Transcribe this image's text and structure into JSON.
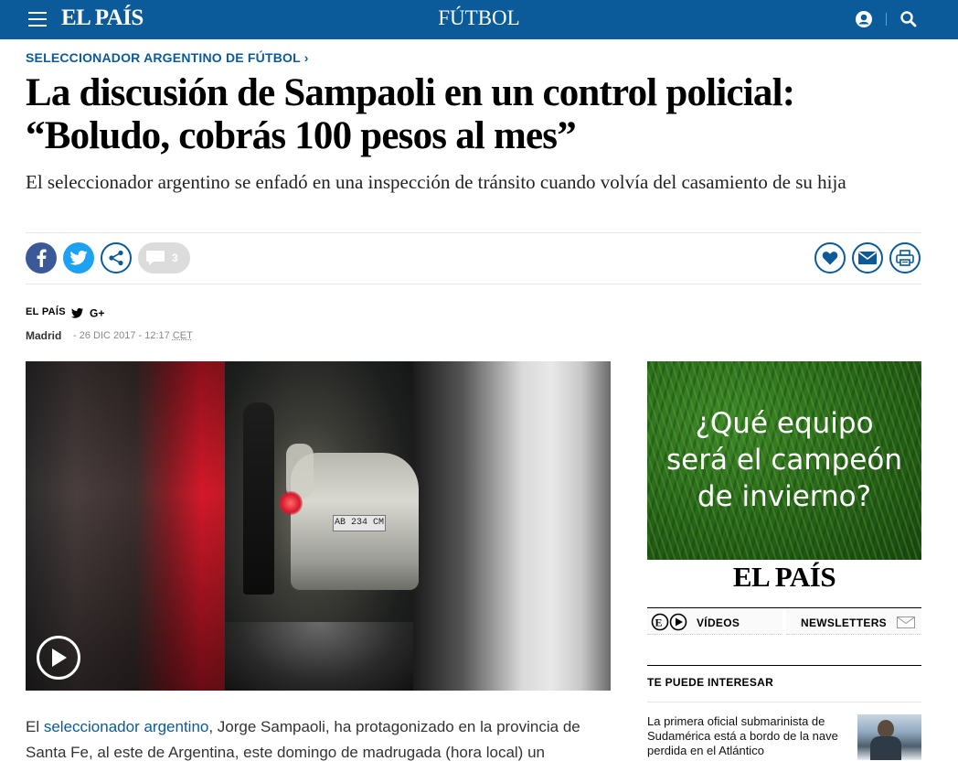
{
  "header": {
    "logo": "EL PAÍS",
    "section": "FÚTBOL",
    "brand_color": "#0b5a9a"
  },
  "article": {
    "kicker": "SELECCIONADOR ARGENTINO DE FÚTBOL ›",
    "headline": "La discusión de Sampaoli en un control policial: “Boludo, cobrás 100 pesos al mes”",
    "subtitle": "El seleccionador argentino se enfadó en una inspección de tránsito cuando volvía del casamiento de su hija",
    "comments_count": "3",
    "byline": "EL PAÍS",
    "place": "Madrid",
    "date_text": "- 26 DIC 2017 - 12:17 ",
    "timezone": "CET",
    "video_plate": "AB 234 CM",
    "body_link": "seleccionador argentino",
    "body_pre": "El ",
    "body_post": ", Jorge Sampaoli, ha protagonizado en la provincia de Santa Fe, al este de Argentina, este domingo de madrugada (hora local) un"
  },
  "sidebar": {
    "ad_line1": "¿Qué equipo",
    "ad_line2": "será el campeón",
    "ad_line3": "de invierno?",
    "ad_logo": "EL PAÍS",
    "tab_videos": "VÍDEOS",
    "tab_newsletters": "NEWSLETTERS",
    "interes_title": "TE PUEDE INTERESAR",
    "story_text": "La primera oficial submarinista de Sudamérica está a bordo de la nave perdida en el Atlántico"
  },
  "icons": {
    "facebook": "facebook-icon",
    "twitter": "twitter-icon",
    "share": "share-icon",
    "comment": "comment-icon",
    "heart": "heart-icon",
    "mail": "mail-icon",
    "print": "print-icon",
    "play": "play-icon",
    "user": "user-icon",
    "search": "search-icon",
    "menu": "menu-icon"
  }
}
